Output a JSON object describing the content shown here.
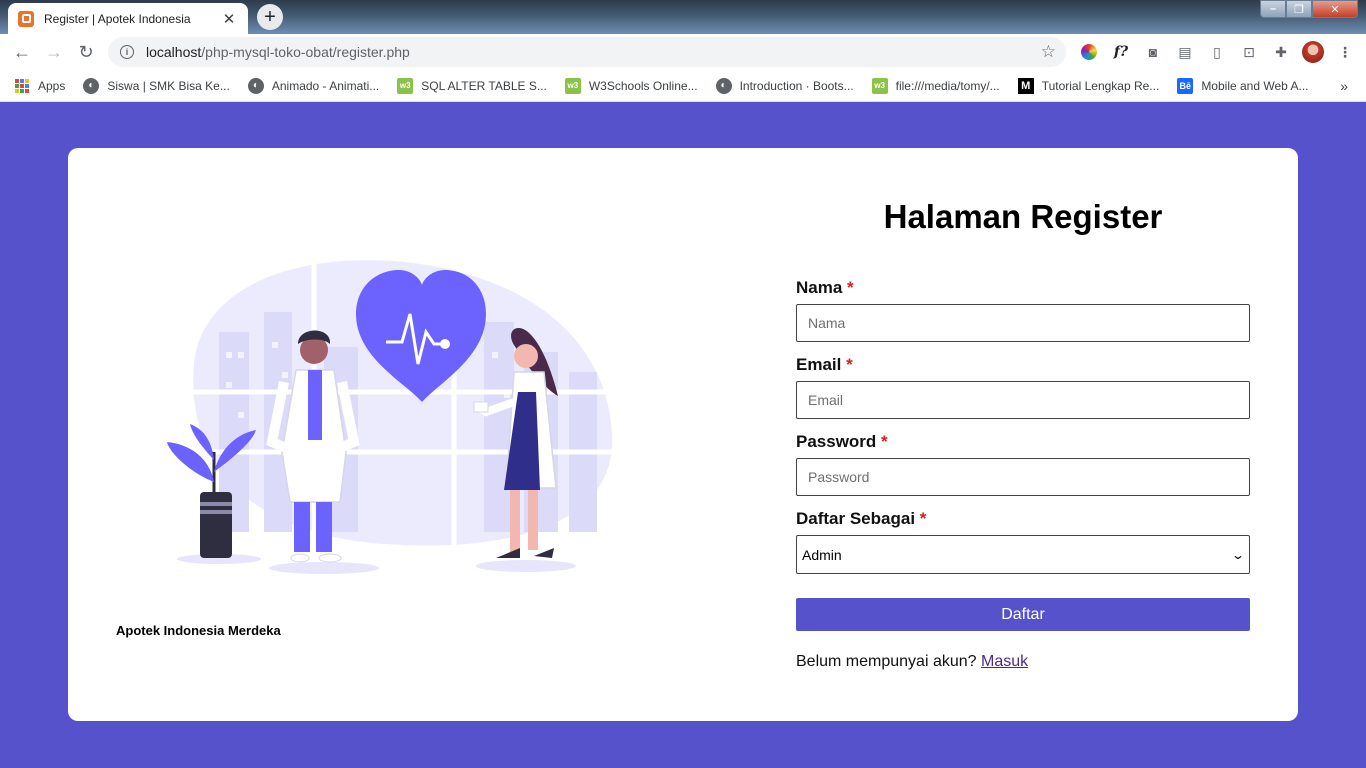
{
  "browser": {
    "tab_title": "Register | Apotek Indonesia",
    "url_host": "localhost",
    "url_path": "/php-mysql-toko-obat/register.php",
    "bookmarks": [
      "Apps",
      "Siswa | SMK Bisa Ke...",
      "Animado - Animati...",
      "SQL ALTER TABLE S...",
      "W3Schools Online...",
      "Introduction · Boots...",
      "file:///media/tomy/...",
      "Tutorial Lengkap Re...",
      "Mobile and Web A..."
    ]
  },
  "page": {
    "caption": "Apotek Indonesia Merdeka",
    "title": "Halaman Register",
    "fields": {
      "nama": {
        "label": "Nama",
        "placeholder": "Nama"
      },
      "email": {
        "label": "Email",
        "placeholder": "Email"
      },
      "password": {
        "label": "Password",
        "placeholder": "Password"
      },
      "role": {
        "label": "Daftar Sebagai",
        "selected": "Admin"
      }
    },
    "required_mark": "*",
    "submit_label": "Daftar",
    "login_prompt": "Belum mempunyai akun?",
    "login_link": "Masuk"
  },
  "colors": {
    "background": "#5652cc",
    "accent": "#5652cc",
    "illustration_primary": "#6c63ff",
    "required": "#e01b1b"
  }
}
